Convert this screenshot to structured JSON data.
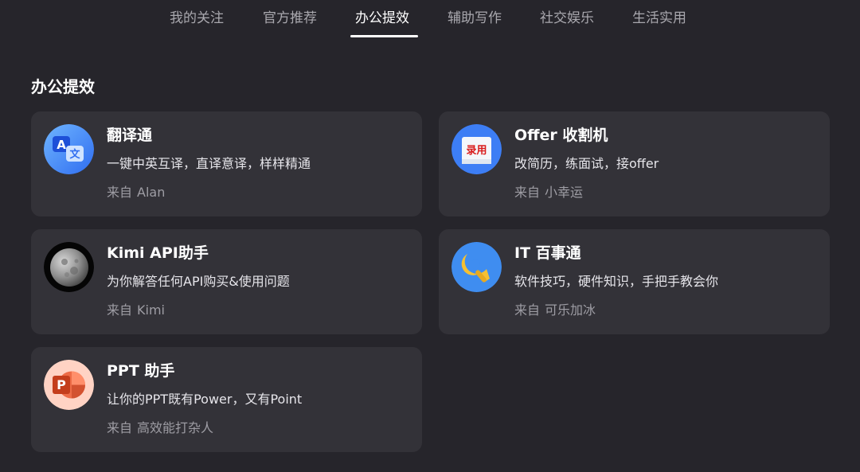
{
  "tabs": [
    {
      "label": "我的关注",
      "active": false
    },
    {
      "label": "官方推荐",
      "active": false
    },
    {
      "label": "办公提效",
      "active": true
    },
    {
      "label": "辅助写作",
      "active": false
    },
    {
      "label": "社交娱乐",
      "active": false
    },
    {
      "label": "生活实用",
      "active": false
    }
  ],
  "section": {
    "title": "办公提效"
  },
  "from_prefix": "来自",
  "cards": [
    {
      "title": "翻译通",
      "description": "一键中英互译，直译意译，样样精通",
      "author": "Alan",
      "icon": "translate-icon"
    },
    {
      "title": "Offer 收割机",
      "description": "改简历，练面试，接offer",
      "author": "小幸运",
      "icon": "hired-stamp-icon",
      "icon_text": "录用"
    },
    {
      "title": "Kimi API助手",
      "description": "为你解答任何API购买&使用问题",
      "author": "Kimi",
      "icon": "moon-icon"
    },
    {
      "title": "IT 百事通",
      "description": "软件技巧，硬件知识，手把手教会你",
      "author": "可乐加冰",
      "icon": "wrench-icon"
    },
    {
      "title": "PPT 助手",
      "description": "让你的PPT既有Power，又有Point",
      "author": "高效能打杂人",
      "icon": "powerpoint-icon",
      "icon_text": "P"
    }
  ],
  "colors": {
    "background": "#26252b",
    "card": "#333238",
    "tab_inactive": "#a9a8ae",
    "tab_active": "#ffffff",
    "author_text": "#9e9da4"
  }
}
